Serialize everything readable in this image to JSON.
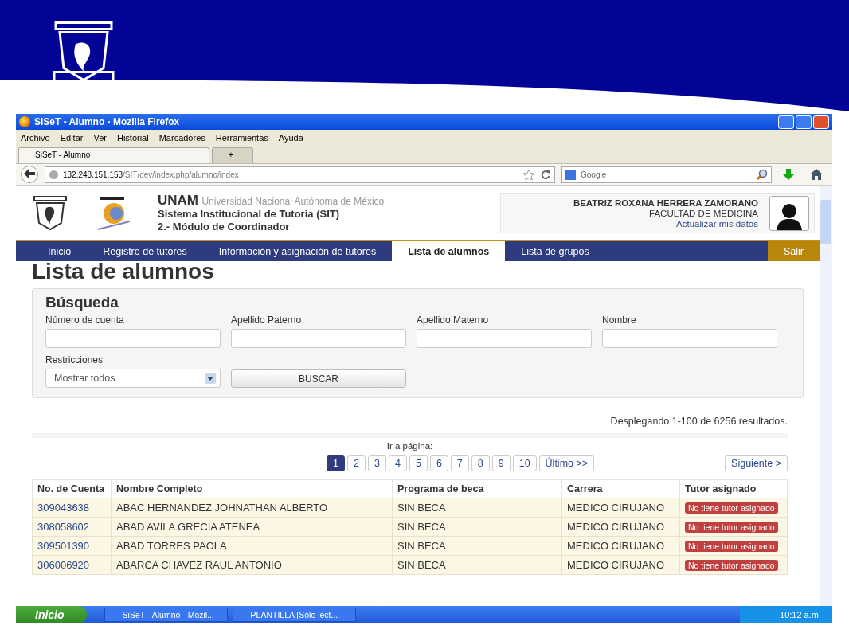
{
  "browser": {
    "title": "SiSeT - Alumno - Mozilla Firefox",
    "menu": [
      "Archivo",
      "Editar",
      "Ver",
      "Historial",
      "Marcadores",
      "Herramientas",
      "Ayuda"
    ],
    "tabs": [
      {
        "label": "SiSeT - Alumno",
        "selected": true
      },
      {
        "label": "+",
        "selected": false
      }
    ],
    "url_host": "132.248.151.153",
    "url_path": "/SIT/dev/index.php/alumno/index",
    "search_placeholder": "Google"
  },
  "site": {
    "brand": "UNAM",
    "brand_sub": "Universidad Nacional Autónoma de México",
    "system": "Sistema Institucional de Tutoria (SIT)",
    "module": "2.- Módulo de Coordinador",
    "user": {
      "name": "BEATRIZ ROXANA HERRERA ZAMORANO",
      "faculty": "FACULTAD DE MEDICINA",
      "link": "Actualizar mis datos"
    },
    "nav": [
      {
        "label": "Inicio",
        "kind": "item",
        "selected": false
      },
      {
        "label": "Registro de tutores",
        "kind": "item",
        "selected": false
      },
      {
        "label": "Información y asignación de tutores",
        "kind": "item",
        "selected": false
      },
      {
        "label": "Lista de alumnos",
        "kind": "item",
        "selected": true
      },
      {
        "label": "Lista de grupos",
        "kind": "item",
        "selected": false
      },
      {
        "label": "Salir",
        "kind": "logout",
        "selected": false
      }
    ]
  },
  "page": {
    "title": "Lista de alumnos",
    "search": {
      "title": "Búsqueda",
      "fields": [
        "Número de cuenta",
        "Apellido Paterno",
        "Apellido Materno",
        "Nombre"
      ],
      "restriction_label": "Restricciones",
      "restriction_value": "Mostrar todos",
      "button": "BUSCAR"
    },
    "results": "Desplegando 1-100 de 6256 resultados.",
    "goto": "Ir a página:",
    "pages": [
      {
        "label": "1",
        "selected": true
      },
      {
        "label": "2",
        "selected": false
      },
      {
        "label": "3",
        "selected": false
      },
      {
        "label": "4",
        "selected": false
      },
      {
        "label": "5",
        "selected": false
      },
      {
        "label": "6",
        "selected": false
      },
      {
        "label": "7",
        "selected": false
      },
      {
        "label": "8",
        "selected": false
      },
      {
        "label": "9",
        "selected": false
      },
      {
        "label": "10",
        "selected": false
      }
    ],
    "last": "Último >>",
    "next": "Siguiente >",
    "table": {
      "columns": [
        "No. de Cuenta",
        "Nombre Completo",
        "Programa de beca",
        "Carrera",
        "Tutor asignado"
      ],
      "rows": [
        {
          "account": "309043638",
          "name": "ABAC HERNANDEZ JOHNATHAN ALBERTO",
          "program": "SIN BECA",
          "career": "MEDICO CIRUJANO",
          "tutor": "No tiene tutor asignado"
        },
        {
          "account": "308058602",
          "name": "ABAD AVILA GRECIA ATENEA",
          "program": "SIN BECA",
          "career": "MEDICO CIRUJANO",
          "tutor": "No tiene tutor asignado"
        },
        {
          "account": "309501390",
          "name": "ABAD TORRES PAOLA",
          "program": "SIN BECA",
          "career": "MEDICO CIRUJANO",
          "tutor": "No tiene tutor asignado"
        },
        {
          "account": "306006920",
          "name": "ABARCA CHAVEZ RAUL ANTONIO",
          "program": "SIN BECA",
          "career": "MEDICO CIRUJANO",
          "tutor": "No tiene tutor asignado"
        }
      ]
    }
  },
  "taskbar": {
    "start": "Inicio",
    "tasks": [
      "SiSeT - Alumno - Mozil...",
      "PLANTILLA [Sólo lect..."
    ],
    "clock": "10:12 a.m."
  }
}
